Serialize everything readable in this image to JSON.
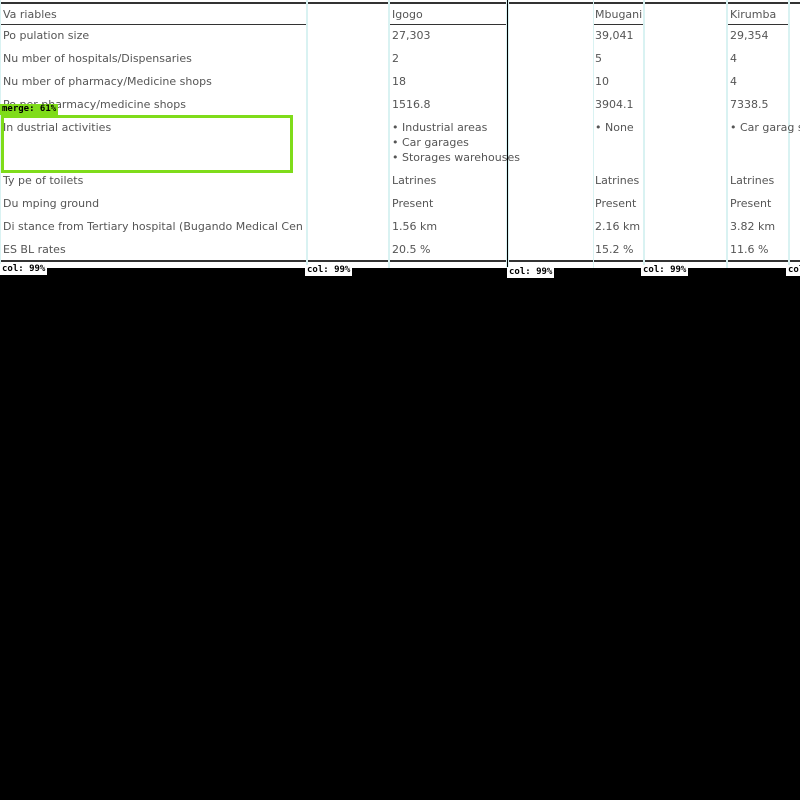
{
  "table": {
    "rows": [
      {
        "label": "Va riables",
        "igogo": "Igogo",
        "mbugani": "Mbugani",
        "kirumba": "Kirumba"
      },
      {
        "label": "Po pulation size",
        "igogo": "27,303",
        "mbugani": "39,041",
        "kirumba": "29,354"
      },
      {
        "label": "Nu mber of hospitals/Dispensaries",
        "igogo": "2",
        "mbugani": "5",
        "kirumba": "4"
      },
      {
        "label": "Nu mber of pharmacy/Medicine shops",
        "igogo": "18",
        "mbugani": "10",
        "kirumba": "4"
      },
      {
        "label": "Po  per pharmacy/medicine shops",
        "igogo": "1516.8",
        "mbugani": "3904.1",
        "kirumba": "7338.5"
      },
      {
        "label": "In dustrial activities",
        "igogo_list": [
          "• Industrial areas",
          "• Car garages",
          "• Storages warehouses"
        ],
        "mbugani": "• None",
        "kirumba": "• Car garag s"
      },
      {
        "label": "Ty pe of toilets",
        "igogo": "Latrines",
        "mbugani": "Latrines",
        "kirumba": "Latrines"
      },
      {
        "label": "Du mping ground",
        "igogo": "Present",
        "mbugani": "Present",
        "kirumba": "Present"
      },
      {
        "label": "Di stance from Tertiary hospital (Bugando Medical Centre)",
        "igogo": "1.56 km",
        "mbugani": "2.16 km",
        "kirumba": "3.82 km"
      },
      {
        "label": "ES BL rates",
        "igogo": "20.5 %",
        "mbugani": "15.2 %",
        "kirumba": "11.6 %"
      }
    ]
  },
  "overlays": {
    "col_label": "col: 99%",
    "col_label_partial": "col",
    "merge_label": "merge: 61%",
    "merge_color": "#7fdc1a"
  }
}
